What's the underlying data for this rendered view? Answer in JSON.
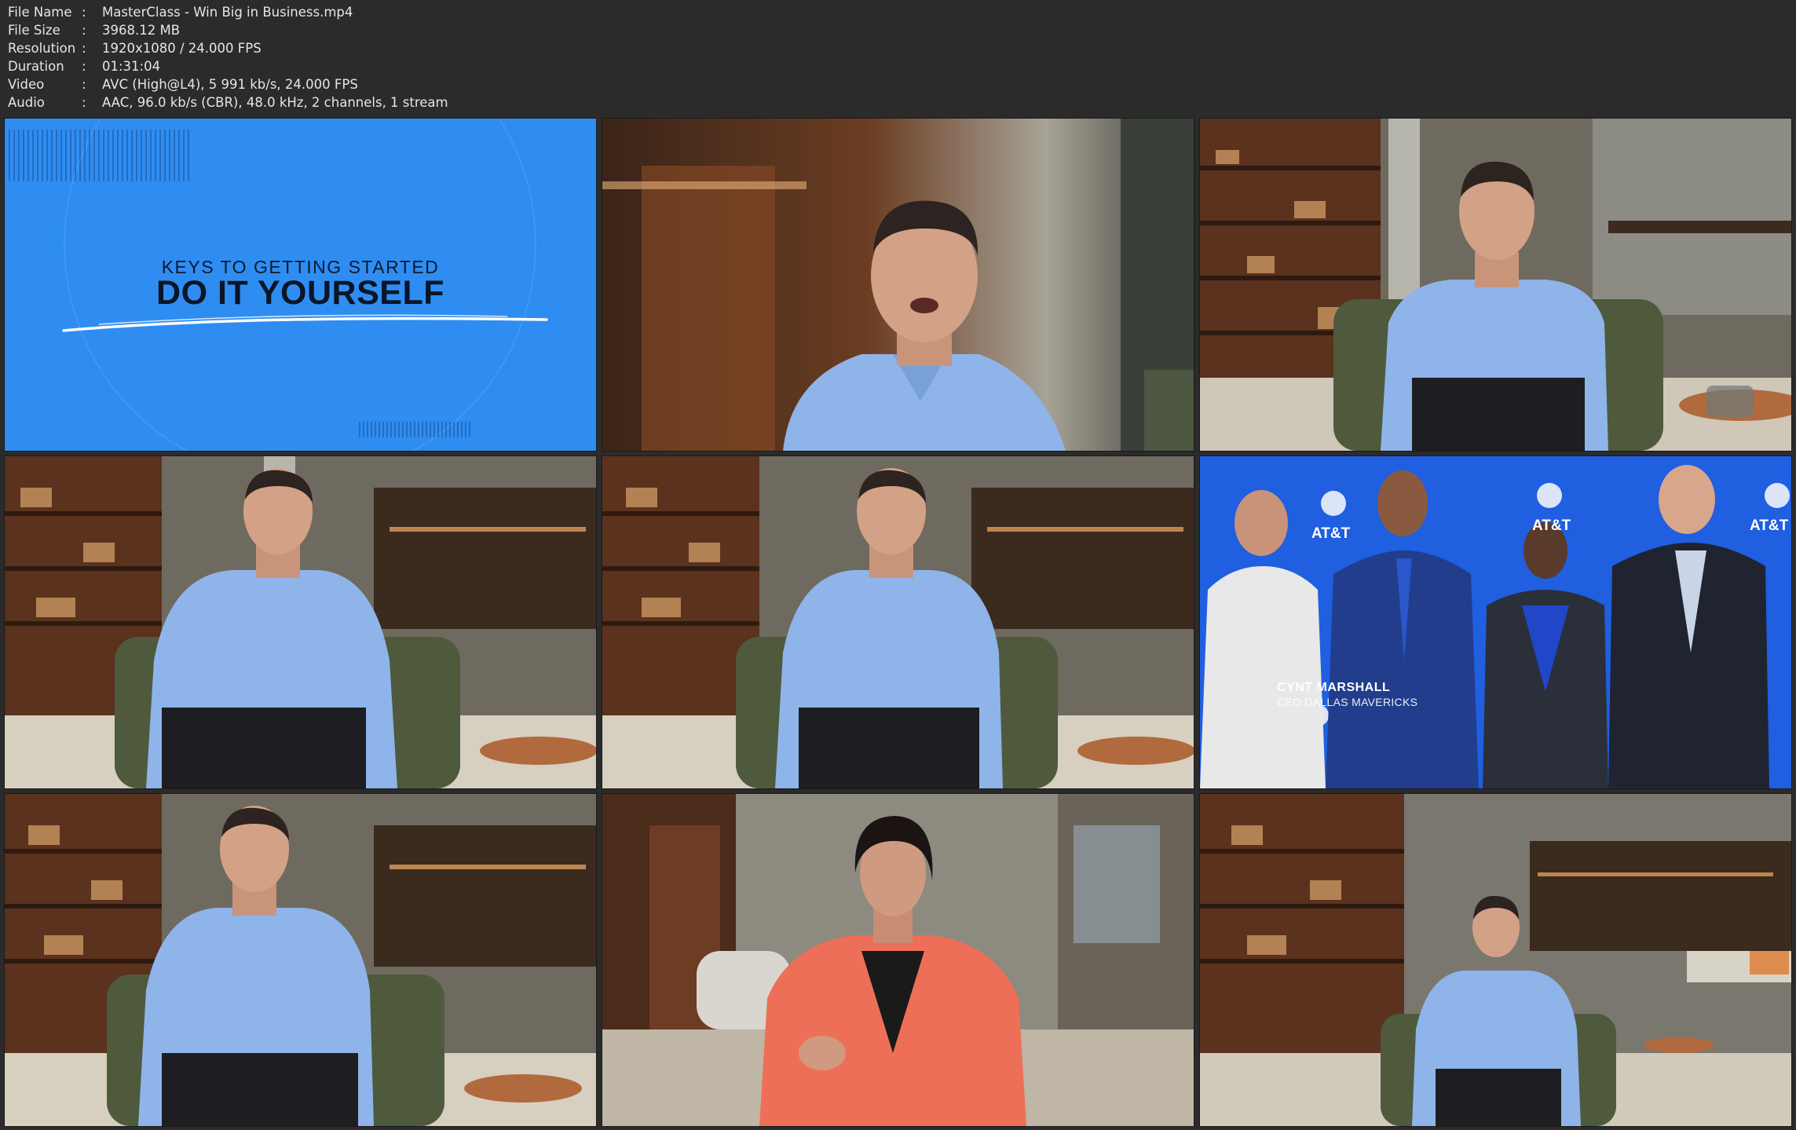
{
  "info": [
    {
      "key": "File Name",
      "sep": ":",
      "value": "MasterClass - Win Big in Business.mp4"
    },
    {
      "key": "File Size",
      "sep": ":",
      "value": "3968.12 MB"
    },
    {
      "key": "Resolution",
      "sep": ":",
      "value": "1920x1080 / 24.000 FPS"
    },
    {
      "key": "Duration",
      "sep": ":",
      "value": "01:31:04"
    },
    {
      "key": "Video",
      "sep": ":",
      "value": "AVC (High@L4), 5 991 kb/s, 24.000 FPS"
    },
    {
      "key": "Audio",
      "sep": ":",
      "value": "AAC, 96.0 kb/s (CBR), 48.0 kHz, 2 channels, 1 stream"
    }
  ],
  "frames": {
    "title_card": {
      "subtitle": "KEYS TO GETTING STARTED",
      "title": "DO IT YOURSELF"
    },
    "press_photo": {
      "caption_name": "CYNT MARSHALL",
      "caption_role": "CEO DALLAS MAVERICKS",
      "logo_text": "AT&T"
    }
  },
  "colors": {
    "title_card_blue": "#2f8df2",
    "backdrop_blue": "#1f5fe0",
    "shirt_blue": "#8fb4ea",
    "blazer_coral": "#ee6f57",
    "wood": "#6b3d22"
  }
}
